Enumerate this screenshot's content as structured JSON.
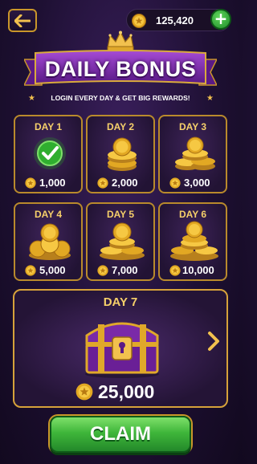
{
  "header": {
    "back_label": "back",
    "balance": "125,420",
    "add_label": "+"
  },
  "banner": {
    "title": "DAILY BONUS",
    "subtitle": "LOGIN EVERY DAY & GET BIG REWARDS!"
  },
  "days": [
    {
      "label": "DAY 1",
      "amount": "1,000",
      "claimed": true
    },
    {
      "label": "DAY 2",
      "amount": "2,000",
      "claimed": false
    },
    {
      "label": "DAY 3",
      "amount": "3,000",
      "claimed": false
    },
    {
      "label": "DAY 4",
      "amount": "5,000",
      "claimed": false
    },
    {
      "label": "DAY 5",
      "amount": "7,000",
      "claimed": false
    },
    {
      "label": "DAY 6",
      "amount": "10,000",
      "claimed": false
    }
  ],
  "grand": {
    "label": "DAY 7",
    "amount": "25,000"
  },
  "claim_label": "CLAIM",
  "colors": {
    "gold": "#f6d06a",
    "border_gold": "#b98a2c",
    "banner_purple": "#7a2aa8",
    "claim_green": "#3fb63a"
  },
  "icons": {
    "back": "arrow-left-icon",
    "coin": "star-coin-icon",
    "add": "plus-icon",
    "crown": "crown-icon",
    "check": "check-icon",
    "chest": "treasure-chest-icon",
    "next": "chevron-right-icon"
  }
}
